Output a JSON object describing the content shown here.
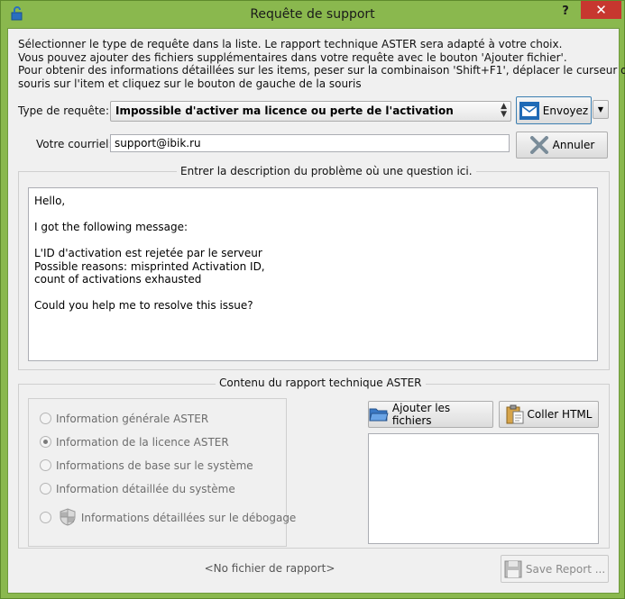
{
  "window": {
    "title": "Requête de support",
    "help_label": "?",
    "close_label": "✕"
  },
  "info_lines": [
    "Sélectionner le type de requête dans la liste. Le rapport technique ASTER sera adapté à votre choix.",
    "Vous pouvez ajouter des fichiers supplémentaires dans votre requête avec le bouton 'Ajouter fichier'.",
    "Pour obtenir des informations détaillées sur les items, peser sur la combinaison 'Shift+F1', déplacer le curseur de la",
    "souris sur l'item et cliquez sur le bouton de gauche de la souris"
  ],
  "request_type": {
    "label": "Type de requête:",
    "value": "Impossible d'activer ma licence ou perte de l'activation"
  },
  "email": {
    "label": "Votre courriel:",
    "value": "support@ibik.ru"
  },
  "buttons": {
    "send": "Envoyez",
    "cancel": "Annuler",
    "add_files": "Ajouter les fichiers",
    "paste_html": "Coller HTML",
    "save_report": "Save Report ..."
  },
  "description": {
    "group_title": "Entrer la description du problème où une question ici.",
    "lines": [
      "Hello,",
      "",
      "I got the following message:",
      "",
      "L'ID d'activation est rejetée par le serveur",
      "Possible reasons: misprinted Activation ID,",
      "count of activations exhausted",
      "",
      "Could you help me to resolve this issue?"
    ]
  },
  "report": {
    "group_title": "Contenu du rapport technique ASTER",
    "options": [
      {
        "label": "Information générale ASTER",
        "checked": false
      },
      {
        "label": "Information de la licence ASTER",
        "checked": true
      },
      {
        "label": "Informations de base sur le système",
        "checked": false
      },
      {
        "label": "Information détaillée du système",
        "checked": false
      },
      {
        "label": "Informations détaillées sur le débogage",
        "checked": false
      }
    ],
    "no_file": "<No fichier de rapport>"
  },
  "icons": {
    "lock": "lock-icon",
    "send": "envelope-icon",
    "cancel": "x-icon",
    "add_files": "folder-icon",
    "paste_html": "clipboard-icon",
    "save_report": "floppy-icon",
    "debug": "shield-icon"
  },
  "colors": {
    "title_bar": "#8ab84e",
    "close_button": "#c7372f",
    "send_icon": "#1f6ab6"
  }
}
